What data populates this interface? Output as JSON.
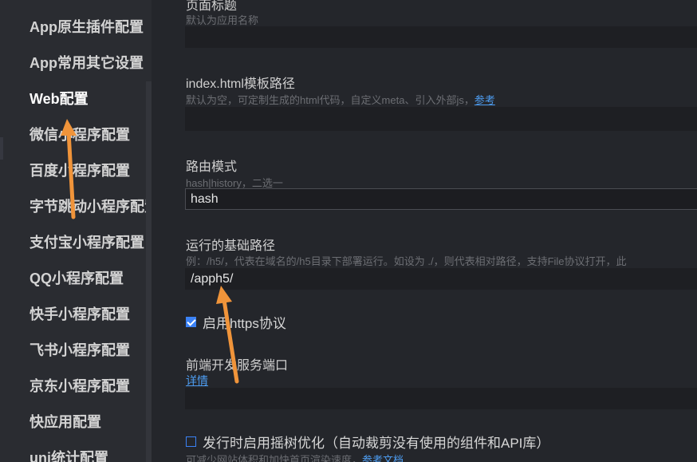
{
  "sidebar": {
    "items": [
      {
        "label": "App原生插件配置",
        "active": false
      },
      {
        "label": "App常用其它设置",
        "active": false
      },
      {
        "label": "Web配置",
        "active": true
      },
      {
        "label": "微信小程序配置",
        "active": false
      },
      {
        "label": "百度小程序配置",
        "active": false
      },
      {
        "label": "字节跳动小程序配置",
        "active": false
      },
      {
        "label": "支付宝小程序配置",
        "active": false
      },
      {
        "label": "QQ小程序配置",
        "active": false
      },
      {
        "label": "快手小程序配置",
        "active": false
      },
      {
        "label": "飞书小程序配置",
        "active": false
      },
      {
        "label": "京东小程序配置",
        "active": false
      },
      {
        "label": "快应用配置",
        "active": false
      },
      {
        "label": "uni统计配置",
        "active": false
      }
    ]
  },
  "main": {
    "page_title": {
      "label": "页面标题",
      "hint": "默认为应用名称",
      "value": ""
    },
    "index_template": {
      "label": "index.html模板路径",
      "hint": "默认为空，可定制生成的html代码，自定义meta、引入外部js，",
      "hint_link": "参考",
      "value": ""
    },
    "router_mode": {
      "label": "路由模式",
      "hint": "hash|history，二选一",
      "value": "hash"
    },
    "base_path": {
      "label": "运行的基础路径",
      "hint": "例：/h5/，代表在域名的/h5目录下部署运行。如设为 ./，则代表相对路径，支持File协议打开，此",
      "value": "/apph5/"
    },
    "https": {
      "label": "启用https协议",
      "checked": true
    },
    "dev_port": {
      "label": "前端开发服务端口",
      "link": "详情",
      "value": ""
    },
    "tree_shaking": {
      "label": "发行时启用摇树优化（自动裁剪没有使用的组件和API库）",
      "hint": "可减少网站体积和加快首页渲染速度，",
      "hint_link": "参考文档",
      "checked": false
    }
  },
  "colors": {
    "background": "#24262b",
    "sidebar": "#2a2c31",
    "input": "#1e1f23",
    "accent": "#3b82f6",
    "link": "#4d9cf0",
    "annotation_arrow": "#f0943a"
  }
}
